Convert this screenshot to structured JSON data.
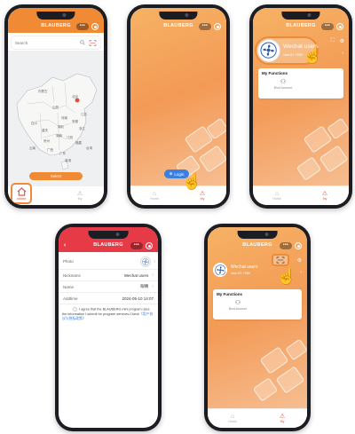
{
  "brand": "BLAUBERG",
  "caps": {
    "more": "•••"
  },
  "map": {
    "search_placeholder": "Search",
    "select_button": "Select",
    "tab_online": "online",
    "tab_my": "My",
    "labels": [
      "内蒙古",
      "北京",
      "山西",
      "河南",
      "四川",
      "湖北",
      "安徽",
      "江苏",
      "重庆",
      "湖南",
      "浙江",
      "贵州",
      "江西",
      "云南",
      "福建",
      "广西",
      "广东",
      "台湾",
      "香港"
    ]
  },
  "home": {
    "login_button": "Login",
    "tab_home": "Home",
    "tab_my": "My"
  },
  "profile": {
    "user_name": "Wechat users",
    "user_id": "User ID: 7999",
    "my_functions": "My Functions",
    "bind_account": "Bind Account",
    "tab_home": "Home",
    "tab_my": "My"
  },
  "form": {
    "photo_label": "Photo",
    "nickname_label": "Nicknams",
    "nickname_value": "Wechat users",
    "name_label": "Name",
    "name_value": "眼睛",
    "addtime_label": "Addtime",
    "addtime_value": "2024-05-10 14:07",
    "agree_text": "I agree that the BLAUBERG mini program uses the information I submit for program services.Check",
    "agree_link": "《用户协议与隐私政策》"
  },
  "scan": {
    "user_name": "Wechat users",
    "user_id": "User ID: 7999",
    "my_functions": "My Functions",
    "bind_account": "Bind Account",
    "tab_home": "Home",
    "tab_my": "My"
  },
  "colors": {
    "orange": "#f08a34",
    "red": "#e63a46",
    "accent": "#e34a3a",
    "blue": "#3b7fe0"
  }
}
